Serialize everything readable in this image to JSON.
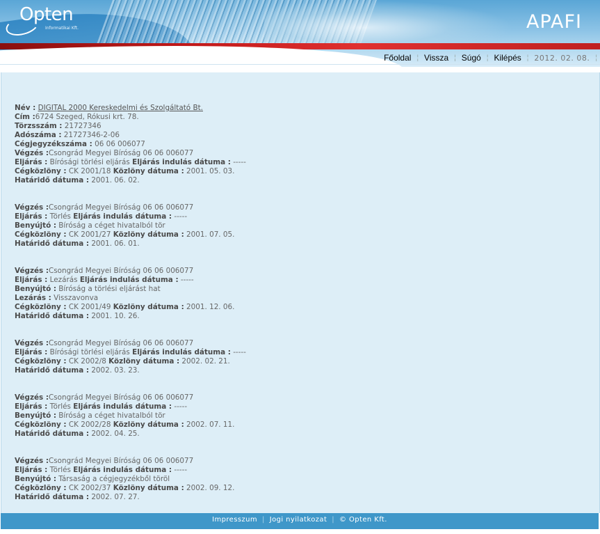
{
  "header": {
    "logo": {
      "name": "Opten",
      "sub": "Informatikai Kft."
    },
    "app_title": "APAFI"
  },
  "nav": {
    "items": [
      "Főoldal",
      "Vissza",
      "Súgó",
      "Kilépés"
    ],
    "date": "2012. 02. 08."
  },
  "company": {
    "nev_label": "Név :",
    "nev_value": "DIGITAL 2000 Kereskedelmi és Szolgáltató Bt.",
    "cim_label": "Cím :",
    "cim_value": "6724 Szeged, Rókusi krt. 78.",
    "torzsszam_label": "Törzsszám :",
    "torzsszam_value": "21727346",
    "adoszam_label": "Adószáma :",
    "adoszam_value": "21727346-2-06",
    "cegjegyzekszam_label": "Cégjegyzékszáma :",
    "cegjegyzekszam_value": "06 06 006077"
  },
  "labels": {
    "vegzes": "Végzés :",
    "eljaras": "Eljárás :",
    "eljaras_indulas": "Eljárás indulás dátuma :",
    "cegkozlony": "Cégközlöny :",
    "kozlony_datuma": "Közlöny dátuma :",
    "hatarido": "Határidő dátuma :",
    "benyujto": "Benyújtó :",
    "lezaras": "Lezárás :"
  },
  "records": [
    {
      "vegzes": "Csongrád Megyei Bíróság 06 06 006077",
      "eljaras": "Bírósági törlési eljárás",
      "indulas": "-----",
      "benyujto": null,
      "lezaras": null,
      "cegkozlony": "CK 2001/18",
      "kozlony_datum": "2001. 05. 03.",
      "hatarido": "2001. 06. 02."
    },
    {
      "vegzes": "Csongrád Megyei Bíróság 06 06 006077",
      "eljaras": "Törlés",
      "indulas": "-----",
      "benyujto": "Bíróság a céget hivatalból tör",
      "lezaras": null,
      "cegkozlony": "CK 2001/27",
      "kozlony_datum": "2001. 07. 05.",
      "hatarido": "2001. 06. 01."
    },
    {
      "vegzes": "Csongrád Megyei Bíróság 06 06 006077",
      "eljaras": "Lezárás",
      "indulas": "-----",
      "benyujto": "Bíróság a törlési eljárást hat",
      "lezaras": "Visszavonva",
      "cegkozlony": "CK 2001/49",
      "kozlony_datum": "2001. 12. 06.",
      "hatarido": "2001. 10. 26."
    },
    {
      "vegzes": "Csongrád Megyei Bíróság 06 06 006077",
      "eljaras": "Bírósági törlési eljárás",
      "indulas": "-----",
      "benyujto": null,
      "lezaras": null,
      "cegkozlony": "CK 2002/8",
      "kozlony_datum": "2002. 02. 21.",
      "hatarido": "2002. 03. 23."
    },
    {
      "vegzes": "Csongrád Megyei Bíróság 06 06 006077",
      "eljaras": "Törlés",
      "indulas": "-----",
      "benyujto": "Bíróság a céget hivatalból tör",
      "lezaras": null,
      "cegkozlony": "CK 2002/28",
      "kozlony_datum": "2002. 07. 11.",
      "hatarido": "2002. 04. 25."
    },
    {
      "vegzes": "Csongrád Megyei Bíróság 06 06 006077",
      "eljaras": "Törlés",
      "indulas": "-----",
      "benyujto": "Társaság a cégjegyzékből töröl",
      "lezaras": null,
      "cegkozlony": "CK 2002/37",
      "kozlony_datum": "2002. 09. 12.",
      "hatarido": "2002. 07. 27."
    }
  ],
  "footer": {
    "links": [
      "Impresszum",
      "Jogi nyilatkozat",
      "© Opten Kft."
    ]
  }
}
